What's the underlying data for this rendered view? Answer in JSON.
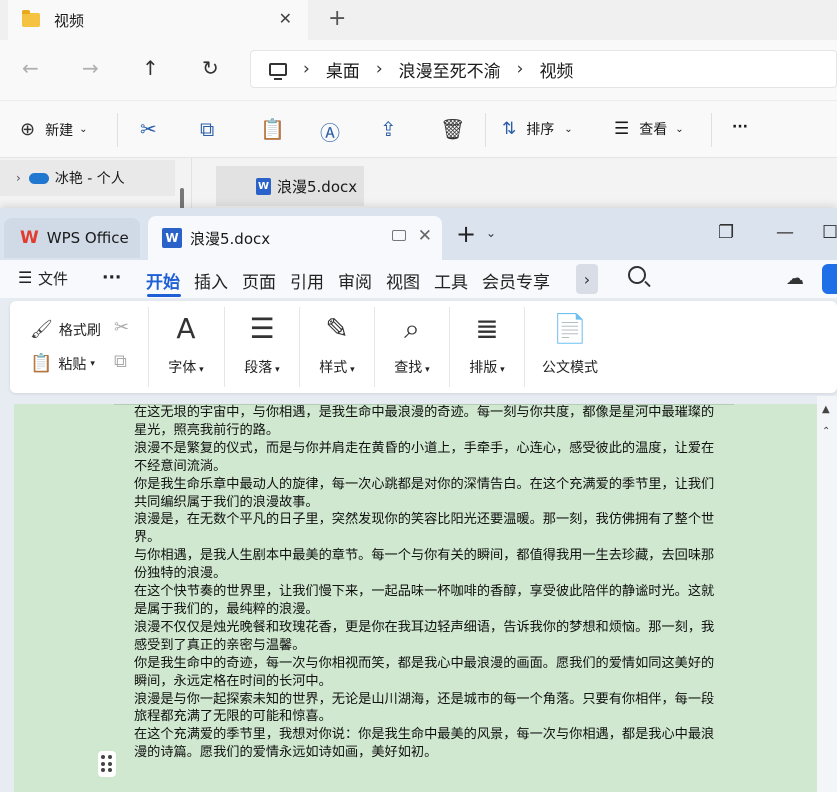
{
  "explorer": {
    "tab_title": "视频",
    "breadcrumb": [
      "桌面",
      "浪漫至死不渝",
      "视频"
    ],
    "commands": {
      "new": "新建",
      "sort": "排序",
      "view": "查看",
      "more": "···"
    },
    "sidebar_item": "冰艳 - 个人",
    "file_name": "浪漫5.docx"
  },
  "wps": {
    "home_tab": "WPS Office",
    "doc_tab": "浪漫5.docx",
    "menu": {
      "file": "文件",
      "more": "···",
      "items": [
        "开始",
        "插入",
        "页面",
        "引用",
        "审阅",
        "视图",
        "工具",
        "会员专享"
      ],
      "active": "开始"
    },
    "ribbon": {
      "format_painter": "格式刷",
      "paste": "粘贴",
      "font": "字体",
      "paragraph": "段落",
      "style": "样式",
      "find": "查找",
      "layout": "排版",
      "official": "公文模式"
    },
    "document": {
      "paragraphs": [
        "在这无垠的宇宙中，与你相遇，是我生命中最浪漫的奇迹。每一刻与你共度，都像是星河中最璀璨的星光，照亮我前行的路。",
        "浪漫不是繁复的仪式，而是与你并肩走在黄昏的小道上，手牵手，心连心，感受彼此的温度，让爱在不经意间流淌。",
        "你是我生命乐章中最动人的旋律，每一次心跳都是对你的深情告白。在这个充满爱的季节里，让我们共同编织属于我们的浪漫故事。",
        "浪漫是，在无数个平凡的日子里，突然发现你的笑容比阳光还要温暖。那一刻，我仿佛拥有了整个世界。",
        "与你相遇，是我人生剧本中最美的章节。每一个与你有关的瞬间，都值得我用一生去珍藏，去回味那份独特的浪漫。",
        "在这个快节奏的世界里，让我们慢下来，一起品味一杯咖啡的香醇，享受彼此陪伴的静谧时光。这就是属于我们的，最纯粹的浪漫。",
        "浪漫不仅仅是烛光晚餐和玫瑰花香，更是你在我耳边轻声细语，告诉我你的梦想和烦恼。那一刻，我感受到了真正的亲密与温馨。",
        "你是我生命中的奇迹，每一次与你相视而笑，都是我心中最浪漫的画面。愿我们的爱情如同这美好的瞬间，永远定格在时间的长河中。",
        "浪漫是与你一起探索未知的世界，无论是山川湖海，还是城市的每一个角落。只要有你相伴，每一段旅程都充满了无限的可能和惊喜。",
        "在这个充满爱的季节里，我想对你说：你是我生命中最美的风景，每一次与你相遇，都是我心中最浪漫的诗篇。愿我们的爱情永远如诗如画，美好如初。"
      ]
    }
  },
  "colors": {
    "accent": "#1f5fd6",
    "page": "#cfe8cf",
    "wps_red": "#e33b2e"
  }
}
